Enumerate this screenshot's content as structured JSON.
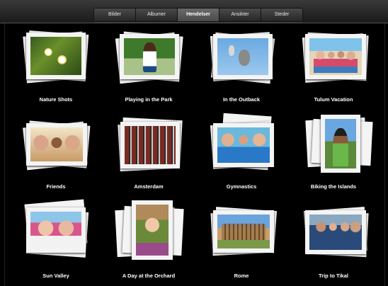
{
  "tabs": [
    {
      "label": "Bilder",
      "active": false
    },
    {
      "label": "Albumer",
      "active": false
    },
    {
      "label": "Hendelser",
      "active": true
    },
    {
      "label": "Ansikter",
      "active": false
    },
    {
      "label": "Steder",
      "active": false
    }
  ],
  "events": [
    {
      "title": "Nature Shots"
    },
    {
      "title": "Playing in the Park"
    },
    {
      "title": "In the Outback"
    },
    {
      "title": "Tulum Vacation"
    },
    {
      "title": "Friends"
    },
    {
      "title": "Amsterdam"
    },
    {
      "title": "Gymnastics"
    },
    {
      "title": "Biking the Islands"
    },
    {
      "title": "Sun Valley"
    },
    {
      "title": "A Day at the Orchard"
    },
    {
      "title": "Rome"
    },
    {
      "title": "Trip to Tikal"
    }
  ]
}
